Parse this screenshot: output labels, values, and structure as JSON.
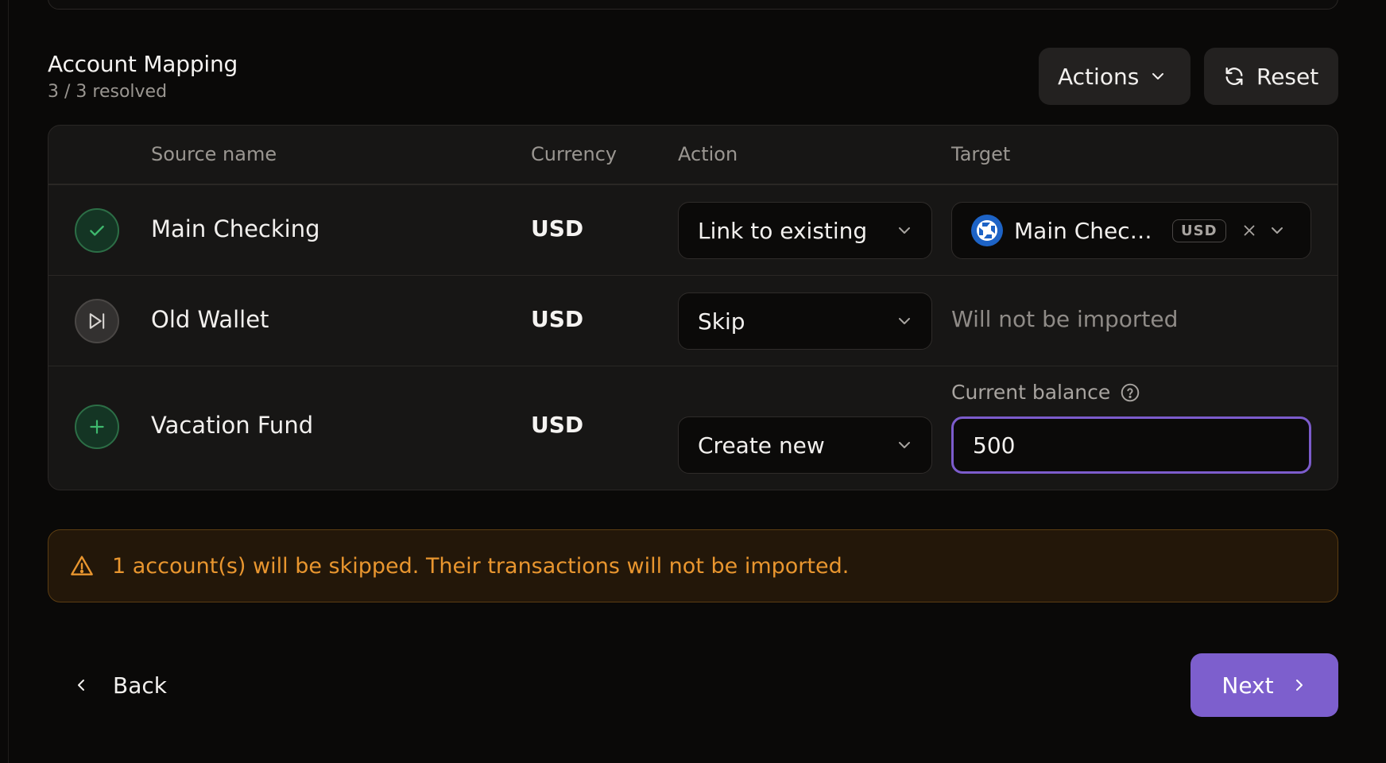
{
  "section": {
    "title": "Account Mapping",
    "subtitle": "3 / 3 resolved"
  },
  "header_actions": {
    "actions_label": "Actions",
    "reset_label": "Reset"
  },
  "table": {
    "columns": [
      "Source name",
      "Currency",
      "Action",
      "Target"
    ],
    "rows": [
      {
        "status": "linked",
        "status_icon": "check-icon",
        "name": "Main Checking",
        "currency": "USD",
        "action": "Link to existing",
        "target_name": "Main Checking",
        "target_currency": "USD",
        "target_logo": "bank-logo-icon"
      },
      {
        "status": "skipped",
        "status_icon": "skip-icon",
        "name": "Old Wallet",
        "currency": "USD",
        "action": "Skip",
        "target_text": "Will not be imported"
      },
      {
        "status": "create",
        "status_icon": "plus-icon",
        "name": "Vacation Fund",
        "currency": "USD",
        "action": "Create new",
        "balance_label": "Current balance",
        "balance_value": "500"
      }
    ]
  },
  "alert": {
    "text": "1 account(s) will be skipped. Their transactions will not be imported."
  },
  "footer": {
    "back_label": "Back",
    "next_label": "Next"
  },
  "colors": {
    "accent": "#7d5fcd",
    "success": "#3fb96e",
    "warning": "#e9962f",
    "background": "#0a0908",
    "surface": "#171615"
  }
}
